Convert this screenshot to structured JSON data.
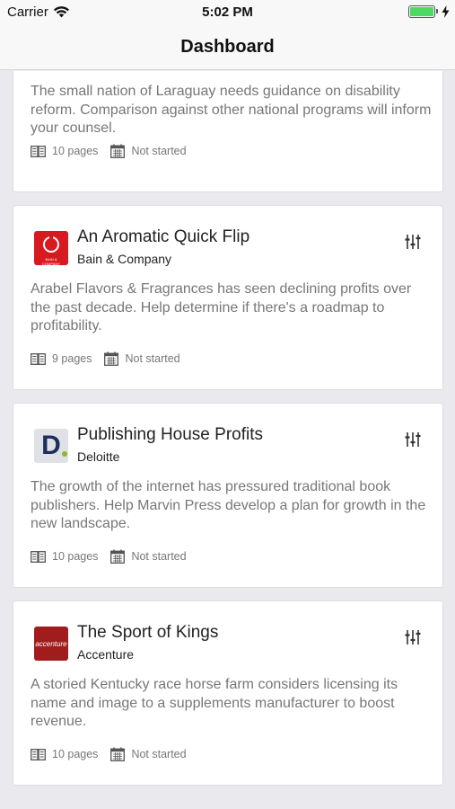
{
  "status_bar": {
    "carrier": "Carrier",
    "time": "5:02 PM"
  },
  "nav": {
    "title": "Dashboard"
  },
  "cases": [
    {
      "description": "The small nation of Laraguay needs guidance on disability reform. Comparison against other national programs will inform your counsel.",
      "pages": "10 pages",
      "status": "Not started"
    },
    {
      "title": "An Aromatic Quick Flip",
      "company": "Bain & Company",
      "logo_text": "BAIN & COMPANY",
      "description": "Arabel Flavors & Fragrances has seen declining profits over the past decade. Help determine if there's a roadmap to profitability.",
      "pages": "9 pages",
      "status": "Not started"
    },
    {
      "title": "Publishing House Profits",
      "company": "Deloitte",
      "logo_text": "D",
      "description": "The growth of the internet has pressured traditional book publishers. Help Marvin Press develop a plan for growth in the new landscape.",
      "pages": "10 pages",
      "status": "Not started"
    },
    {
      "title": "The Sport of Kings",
      "company": "Accenture",
      "logo_text": "accenture",
      "description": "A storied Kentucky race horse farm considers licensing its name and image to a supplements manufacturer to boost revenue.",
      "pages": "10 pages",
      "status": "Not started"
    }
  ],
  "icons": {
    "pages": "book-icon",
    "status": "calendar-icon",
    "filter": "sliders-icon"
  },
  "colors": {
    "background": "#e9e9ee",
    "bain": "#d71920",
    "deloitte_dot": "#86bc25",
    "accenture": "#a11d1d",
    "battery": "#4cd964"
  }
}
